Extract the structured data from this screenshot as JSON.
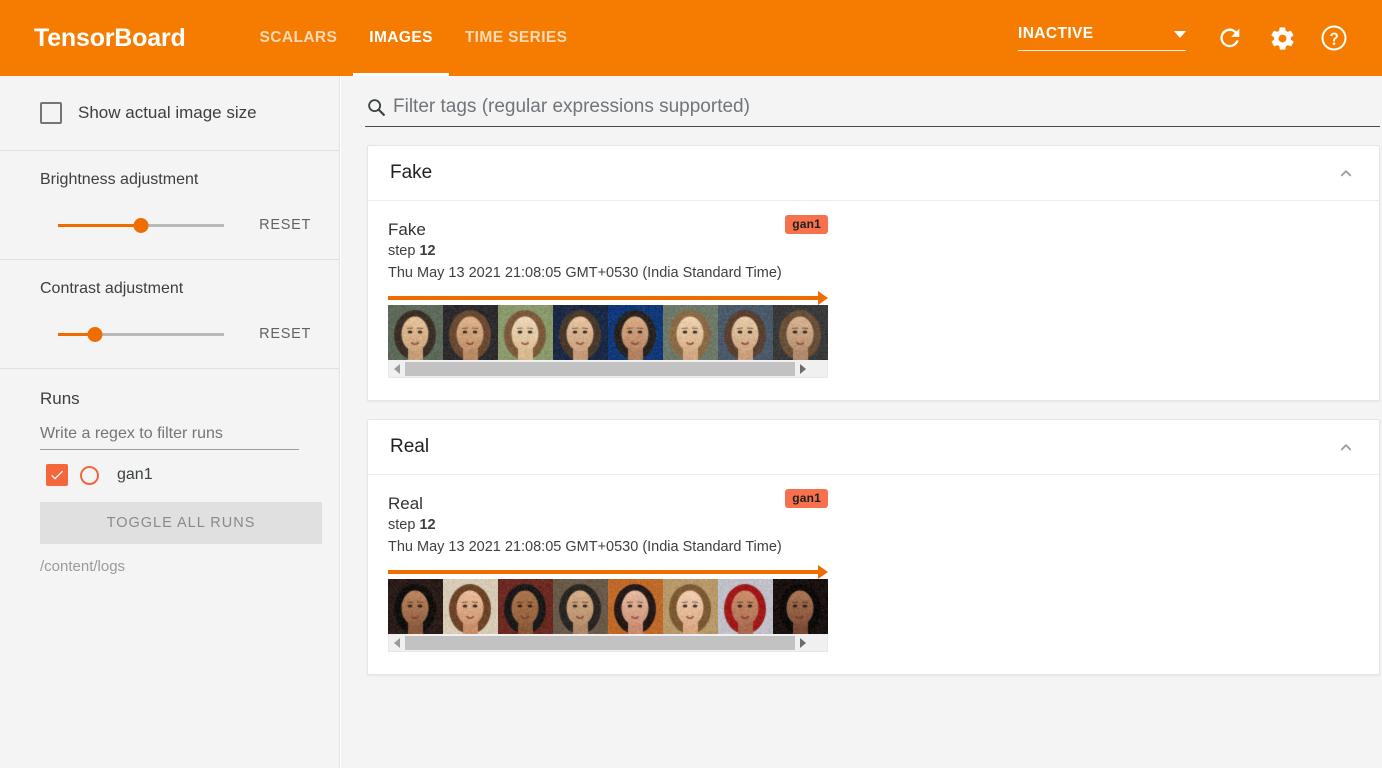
{
  "appbar": {
    "brand": "TensorBoard",
    "tabs": [
      {
        "label": "SCALARS",
        "active": false
      },
      {
        "label": "IMAGES",
        "active": true
      },
      {
        "label": "TIME SERIES",
        "active": false
      }
    ],
    "run_selector": {
      "value": "INACTIVE"
    },
    "icons": {
      "refresh": "refresh-icon",
      "settings": "gear-icon",
      "help": "help-icon"
    },
    "accent_color": "#f57c00"
  },
  "sidebar": {
    "show_actual_image_size": {
      "label": "Show actual image size",
      "checked": false
    },
    "brightness": {
      "title": "Brightness adjustment",
      "reset_label": "RESET",
      "percent": 50
    },
    "contrast": {
      "title": "Contrast adjustment",
      "reset_label": "RESET",
      "percent": 22
    },
    "runs": {
      "title": "Runs",
      "filter_placeholder": "Write a regex to filter runs",
      "filter_value": "",
      "items": [
        {
          "name": "gan1",
          "checked": true,
          "color": "#f4663c"
        }
      ],
      "toggle_all_label": "TOGGLE ALL RUNS",
      "logdir": "/content/logs"
    }
  },
  "main": {
    "filter": {
      "placeholder": "Filter tags (regular expressions supported)",
      "value": "",
      "icon": "search-icon"
    },
    "cards": [
      {
        "title": "Fake",
        "collapse_icon": "chevron-up-icon",
        "tag": {
          "name": "Fake",
          "step_label": "step",
          "step_value": "12",
          "timestamp": "Thu May 13 2021 21:08:05 GMT+0530 (India Standard Time)",
          "run_badge": "gan1",
          "step_slider_percent": 100,
          "image_count": 8,
          "image_kind": "generated-faces"
        }
      },
      {
        "title": "Real",
        "collapse_icon": "chevron-up-icon",
        "tag": {
          "name": "Real",
          "step_label": "step",
          "step_value": "12",
          "timestamp": "Thu May 13 2021 21:08:05 GMT+0530 (India Standard Time)",
          "run_badge": "gan1",
          "step_slider_percent": 100,
          "image_count": 8,
          "image_kind": "real-faces"
        }
      }
    ]
  }
}
